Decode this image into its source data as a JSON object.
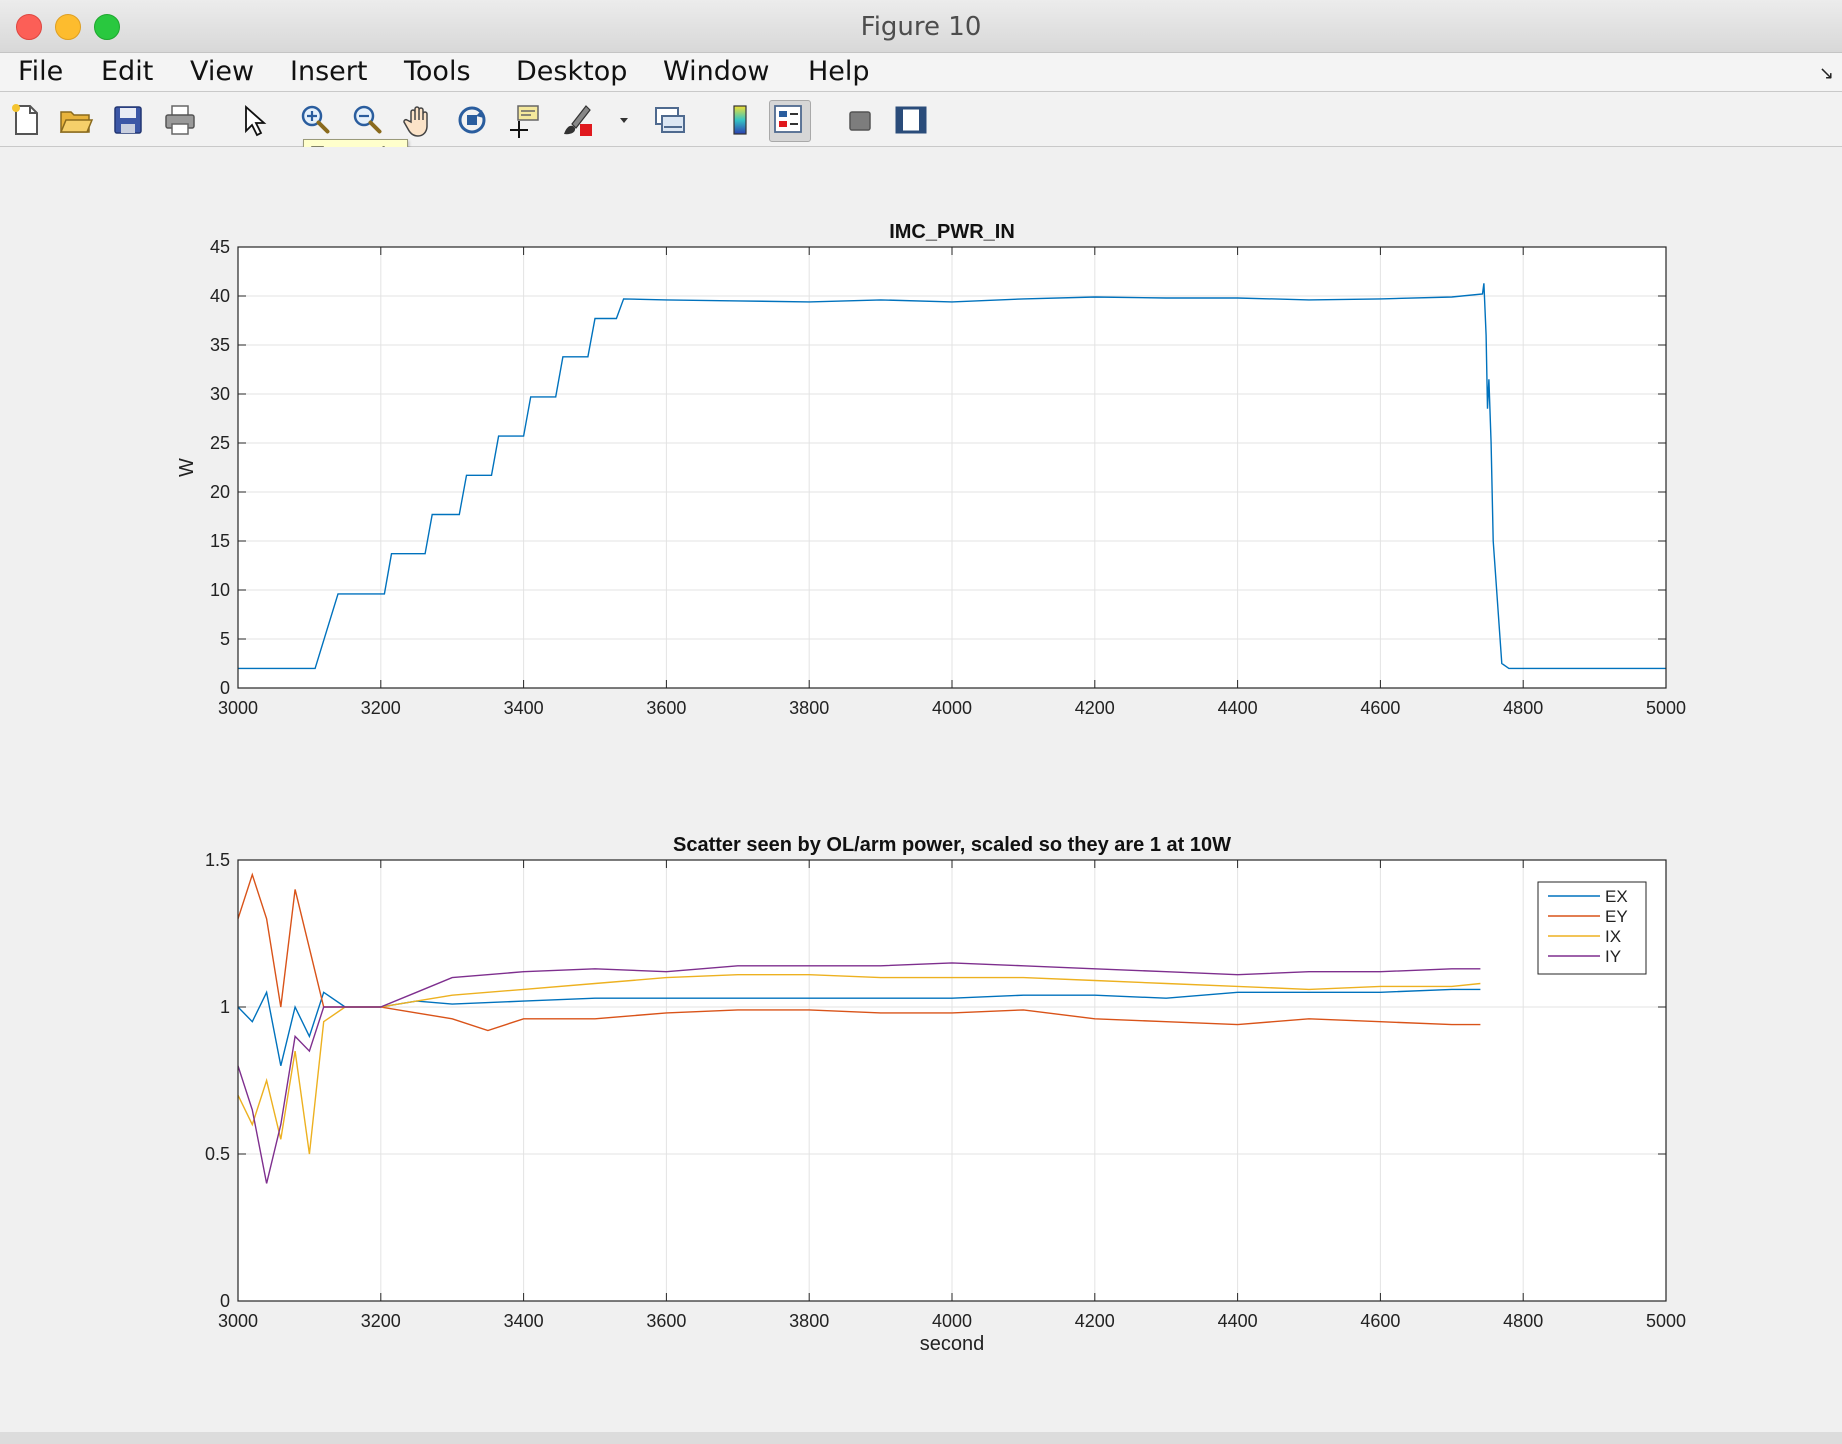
{
  "window": {
    "title": "Figure 10"
  },
  "menu": [
    "File",
    "Edit",
    "View",
    "Insert",
    "Tools",
    "Desktop",
    "Window",
    "Help"
  ],
  "toolbar": {
    "icons": [
      "new-figure-icon",
      "open-file-icon",
      "save-icon",
      "print-icon",
      "edit-plot-icon",
      "zoom-in-icon",
      "zoom-out-icon",
      "pan-icon",
      "rotate-3d-icon",
      "data-cursor-icon",
      "brush-icon",
      "link-plot-icon",
      "colorbar-icon",
      "legend-icon",
      "hide-plot-tools-icon",
      "show-plot-tools-icon"
    ],
    "tooltip": "Zoom In"
  },
  "chart_data": [
    {
      "type": "line",
      "title": "IMC_PWR_IN",
      "xlabel": "",
      "ylabel": "W",
      "xlim": [
        3000,
        5000
      ],
      "ylim": [
        0,
        45
      ],
      "xticks": [
        "3000",
        "3200",
        "3400",
        "3600",
        "3800",
        "4000",
        "4200",
        "4400",
        "4600",
        "4800",
        "5000"
      ],
      "yticks": [
        "0",
        "5",
        "10",
        "15",
        "20",
        "25",
        "30",
        "35",
        "40",
        "45"
      ],
      "grid": true,
      "series": [
        {
          "color": "#0072BD",
          "x": [
            3000,
            3108,
            3140,
            3205,
            3215,
            3262,
            3272,
            3310,
            3320,
            3355,
            3365,
            3400,
            3410,
            3445,
            3455,
            3490,
            3500,
            3530,
            3540,
            3600,
            3700,
            3800,
            3900,
            4000,
            4100,
            4200,
            4300,
            4400,
            4500,
            4600,
            4700,
            4743,
            4745,
            4748,
            4750,
            4752,
            4755,
            4758,
            4770,
            4780,
            4800,
            4900,
            5000
          ],
          "y": [
            2.0,
            2.0,
            9.6,
            9.6,
            13.7,
            13.7,
            17.7,
            17.7,
            21.7,
            21.7,
            25.7,
            25.7,
            29.7,
            29.7,
            33.8,
            33.8,
            37.7,
            37.7,
            39.7,
            39.6,
            39.5,
            39.4,
            39.6,
            39.4,
            39.7,
            39.9,
            39.8,
            39.8,
            39.6,
            39.7,
            39.9,
            40.2,
            41.3,
            36.0,
            28.5,
            31.5,
            25.0,
            15.0,
            2.5,
            2.0,
            2.0,
            2.0,
            2.0
          ]
        }
      ]
    },
    {
      "type": "line",
      "title": "Scatter seen by OL/arm power, scaled so they are 1 at 10W",
      "xlabel": "second",
      "ylabel": "",
      "xlim": [
        3000,
        5000
      ],
      "ylim": [
        0,
        1.5
      ],
      "xticks": [
        "3000",
        "3200",
        "3400",
        "3600",
        "3800",
        "4000",
        "4200",
        "4400",
        "4600",
        "4800",
        "5000"
      ],
      "yticks": [
        "0",
        "0.5",
        "1",
        "1.5"
      ],
      "grid": true,
      "legend": "top-right",
      "series": [
        {
          "name": "EX",
          "color": "#0072BD",
          "x": [
            3000,
            3020,
            3040,
            3060,
            3080,
            3100,
            3120,
            3150,
            3200,
            3250,
            3300,
            3400,
            3500,
            3600,
            3700,
            3800,
            3900,
            4000,
            4100,
            4200,
            4300,
            4400,
            4500,
            4600,
            4700,
            4740
          ],
          "y": [
            1.0,
            0.95,
            1.05,
            0.8,
            1.0,
            0.9,
            1.05,
            1.0,
            1.0,
            1.02,
            1.01,
            1.02,
            1.03,
            1.03,
            1.03,
            1.03,
            1.03,
            1.03,
            1.04,
            1.04,
            1.03,
            1.05,
            1.05,
            1.05,
            1.06,
            1.06
          ]
        },
        {
          "name": "EY",
          "color": "#D95319",
          "x": [
            3000,
            3020,
            3040,
            3060,
            3080,
            3100,
            3120,
            3150,
            3200,
            3250,
            3300,
            3350,
            3400,
            3500,
            3600,
            3700,
            3800,
            3900,
            4000,
            4100,
            4200,
            4300,
            4400,
            4500,
            4600,
            4700,
            4740
          ],
          "y": [
            1.3,
            1.45,
            1.3,
            1.0,
            1.4,
            1.2,
            1.0,
            1.0,
            1.0,
            0.98,
            0.96,
            0.92,
            0.96,
            0.96,
            0.98,
            0.99,
            0.99,
            0.98,
            0.98,
            0.99,
            0.96,
            0.95,
            0.94,
            0.96,
            0.95,
            0.94,
            0.94
          ]
        },
        {
          "name": "IX",
          "color": "#EDB120",
          "x": [
            3000,
            3020,
            3040,
            3060,
            3080,
            3100,
            3120,
            3150,
            3200,
            3250,
            3300,
            3400,
            3500,
            3600,
            3700,
            3800,
            3900,
            4000,
            4100,
            4200,
            4300,
            4400,
            4500,
            4600,
            4700,
            4740
          ],
          "y": [
            0.7,
            0.6,
            0.75,
            0.55,
            0.85,
            0.5,
            0.95,
            1.0,
            1.0,
            1.02,
            1.04,
            1.06,
            1.08,
            1.1,
            1.11,
            1.11,
            1.1,
            1.1,
            1.1,
            1.09,
            1.08,
            1.07,
            1.06,
            1.07,
            1.07,
            1.08
          ]
        },
        {
          "name": "IY",
          "color": "#7E2F8E",
          "x": [
            3000,
            3020,
            3040,
            3060,
            3080,
            3100,
            3120,
            3150,
            3200,
            3250,
            3300,
            3400,
            3500,
            3600,
            3700,
            3800,
            3900,
            4000,
            4100,
            4200,
            4300,
            4400,
            4500,
            4600,
            4700,
            4740
          ],
          "y": [
            0.8,
            0.65,
            0.4,
            0.6,
            0.9,
            0.85,
            1.0,
            1.0,
            1.0,
            1.05,
            1.1,
            1.12,
            1.13,
            1.12,
            1.14,
            1.14,
            1.14,
            1.15,
            1.14,
            1.13,
            1.12,
            1.11,
            1.12,
            1.12,
            1.13,
            1.13
          ]
        }
      ]
    }
  ]
}
